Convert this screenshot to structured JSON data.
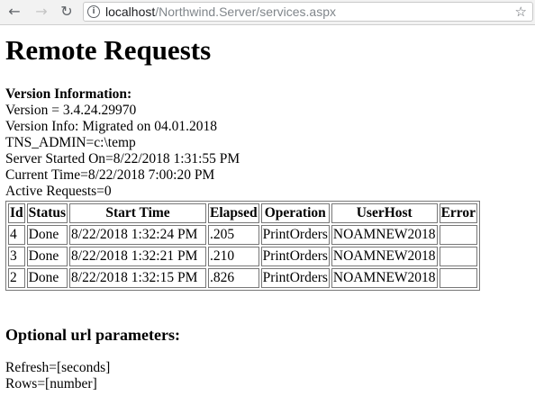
{
  "browser": {
    "back_icon": "arrow-left-icon",
    "forward_icon": "arrow-right-icon",
    "reload_icon": "reload-icon",
    "url_host": "localhost",
    "url_path": "/Northwind.Server/services.aspx",
    "bookmark_icon": "star-icon"
  },
  "page": {
    "title": "Remote Requests",
    "version_heading": "Version Information:",
    "lines": [
      "Version = 3.4.24.29970",
      "Version Info: Migrated on 04.01.2018",
      "TNS_ADMIN=c:\\temp",
      "Server Started On=8/22/2018 1:31:55 PM",
      "Current Time=8/22/2018 7:00:20 PM",
      "Active Requests=0"
    ],
    "table": {
      "headers": [
        "Id",
        "Status",
        "Start Time",
        "Elapsed",
        "Operation",
        "UserHost",
        "Error"
      ],
      "rows": [
        [
          "4",
          "Done",
          "8/22/2018 1:32:24 PM",
          ".205",
          "PrintOrders",
          "NOAMNEW2018",
          ""
        ],
        [
          "3",
          "Done",
          "8/22/2018 1:32:21 PM",
          ".210",
          "PrintOrders",
          "NOAMNEW2018",
          ""
        ],
        [
          "2",
          "Done",
          "8/22/2018 1:32:15 PM",
          ".826",
          "PrintOrders",
          "NOAMNEW2018",
          ""
        ]
      ]
    },
    "params_heading": "Optional url parameters:",
    "params": [
      "Refresh=[seconds]",
      "Rows=[number]"
    ]
  }
}
